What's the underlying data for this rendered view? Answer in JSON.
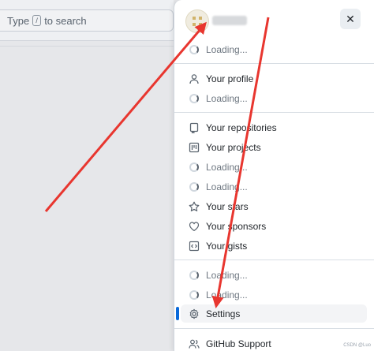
{
  "search": {
    "prefix": "Type",
    "key": "/",
    "suffix": "to search"
  },
  "panel": {
    "close_glyph": "✕",
    "items": {
      "loading1": "Loading...",
      "profile": "Your profile",
      "loading2": "Loading...",
      "repositories": "Your repositories",
      "projects": "Your projects",
      "loading3": "Loading...",
      "loading4": "Loading...",
      "stars": "Your stars",
      "sponsors": "Your sponsors",
      "gists": "Your gists",
      "loading5": "Loading...",
      "loading6": "Loading...",
      "settings": "Settings",
      "support": "GitHub Support"
    },
    "watermark": "CSDN @Luo"
  },
  "colors": {
    "accent": "#0969da",
    "annotation": "#e8362f"
  }
}
